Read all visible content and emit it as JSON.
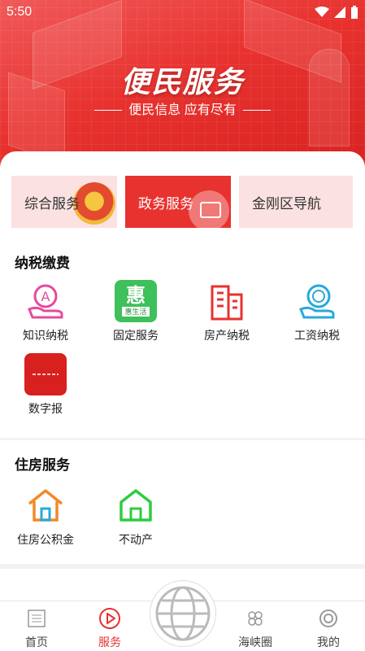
{
  "status_bar": {
    "time": "5:50"
  },
  "hero": {
    "title": "便民服务",
    "subtitle": "便民信息 应有尽有"
  },
  "tabs": [
    {
      "label": "综合服务"
    },
    {
      "label": "政务服务"
    },
    {
      "label": "金刚区导航"
    }
  ],
  "tax_section": {
    "title": "纳税缴费",
    "items": [
      {
        "label": "知识纳税"
      },
      {
        "label": "固定服务",
        "icon_text": "惠",
        "icon_caption": "惠生活"
      },
      {
        "label": "房产纳税"
      },
      {
        "label": "工资纳税"
      },
      {
        "label": "数字报"
      }
    ]
  },
  "housing_section": {
    "title": "住房服务",
    "items": [
      {
        "label": "住房公积金"
      },
      {
        "label": "不动产"
      }
    ]
  },
  "bottom_nav": {
    "items": [
      {
        "label": "首页"
      },
      {
        "label": "服务"
      },
      {
        "label": "海峡圈"
      },
      {
        "label": "我的"
      }
    ]
  },
  "colors": {
    "accent": "#e8322f",
    "tab_bg": "#fbe1e1",
    "green": "#2ecc40"
  }
}
